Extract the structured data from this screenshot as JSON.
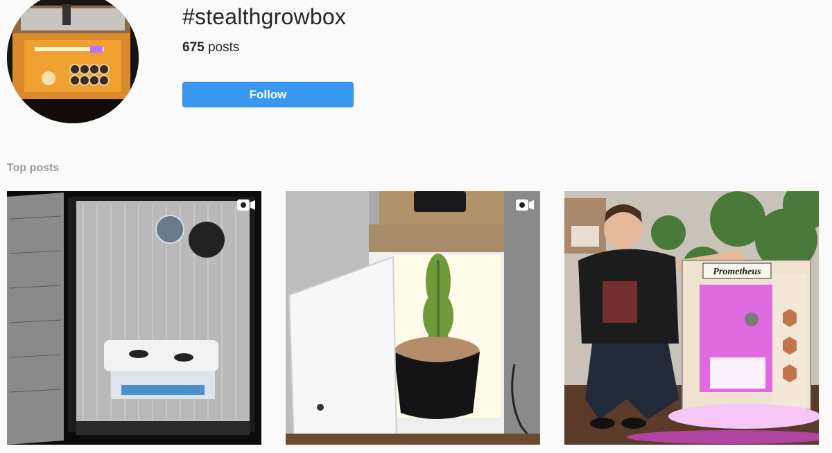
{
  "hashtag": {
    "title": "#stealthgrowbox",
    "post_count": "675",
    "post_count_suffix": " posts",
    "follow_label": "Follow"
  },
  "sections": {
    "top_posts_label": "Top posts"
  },
  "posts": [
    {
      "type": "video",
      "icon": "video-icon",
      "subject": "grow box with reflective walls and hydroponic tub"
    },
    {
      "type": "video",
      "icon": "video-icon",
      "subject": "white cabinet with cannabis plant in fabric pot"
    },
    {
      "type": "image",
      "subject": "man crouching next to Prometheus grow box",
      "sign_text": "Prometheus"
    }
  ]
}
